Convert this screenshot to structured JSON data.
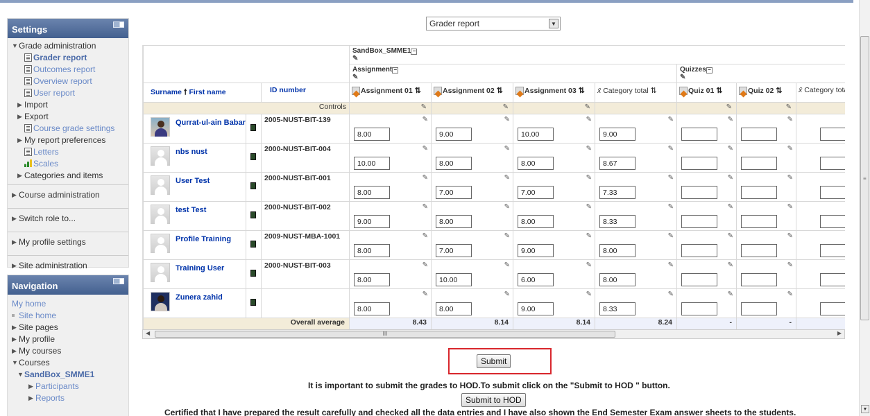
{
  "settings_block": {
    "title": "Settings",
    "items": [
      {
        "label": "Grade administration",
        "arrow": "▼"
      },
      {
        "label": "Grader report"
      },
      {
        "label": "Outcomes report"
      },
      {
        "label": "Overview report"
      },
      {
        "label": "User report"
      },
      {
        "label": "Import",
        "arrow": "▶"
      },
      {
        "label": "Export",
        "arrow": "▶"
      },
      {
        "label": "Course grade settings"
      },
      {
        "label": "My report preferences",
        "arrow": "▶"
      },
      {
        "label": "Letters"
      },
      {
        "label": "Scales"
      },
      {
        "label": "Categories and items",
        "arrow": "▶"
      },
      {
        "label": "Course administration",
        "arrow": "▶"
      },
      {
        "label": "Switch role to...",
        "arrow": "▶"
      },
      {
        "label": "My profile settings",
        "arrow": "▶"
      },
      {
        "label": "Site administration",
        "arrow": "▶"
      }
    ]
  },
  "navigation_block": {
    "title": "Navigation",
    "my_home": "My home",
    "items": [
      {
        "label": "Site home"
      },
      {
        "label": "Site pages",
        "arrow": "▶"
      },
      {
        "label": "My profile",
        "arrow": "▶"
      },
      {
        "label": "My courses",
        "arrow": "▶"
      },
      {
        "label": "Courses",
        "arrow": "▼"
      },
      {
        "label": "SandBox_SMME1",
        "arrow": "▼"
      },
      {
        "label": "Participants",
        "arrow": "▶"
      },
      {
        "label": "Reports",
        "arrow": "▶"
      }
    ]
  },
  "report_select": {
    "value": "Grader report"
  },
  "grid": {
    "course": "SandBox_SMME1",
    "category_assignment": "Assignment",
    "category_quizzes": "Quizzes",
    "col_surname": "Surname",
    "col_firstname": "First name",
    "col_idnumber": "ID number",
    "col_a1": "Assignment 01",
    "col_a2": "Assignment 02",
    "col_a3": "Assignment 03",
    "col_cat_total": "Category total",
    "col_q1": "Quiz 01",
    "col_q2": "Quiz 02",
    "col_cat_total2": "Category total",
    "controls_label": "Controls",
    "overall_label": "Overall average",
    "students": [
      {
        "name": "Qurrat-ul-ain Babar",
        "id": "2005-NUST-BIT-139",
        "a1": "8.00",
        "a2": "9.00",
        "a3": "10.00",
        "total": "9.00",
        "avatar": "photo"
      },
      {
        "name": "nbs nust",
        "id": "2000-NUST-BIT-004",
        "a1": "10.00",
        "a2": "8.00",
        "a3": "8.00",
        "total": "8.67",
        "avatar": "default"
      },
      {
        "name": "User Test",
        "id": "2000-NUST-BIT-001",
        "a1": "8.00",
        "a2": "7.00",
        "a3": "7.00",
        "total": "7.33",
        "avatar": "default"
      },
      {
        "name": "test Test",
        "id": "2000-NUST-BIT-002",
        "a1": "9.00",
        "a2": "8.00",
        "a3": "8.00",
        "total": "8.33",
        "avatar": "default"
      },
      {
        "name": "Profile Training",
        "id": "2009-NUST-MBA-1001",
        "a1": "8.00",
        "a2": "7.00",
        "a3": "9.00",
        "total": "8.00",
        "avatar": "default"
      },
      {
        "name": "Training User",
        "id": "2000-NUST-BIT-003",
        "a1": "8.00",
        "a2": "10.00",
        "a3": "6.00",
        "total": "8.00",
        "avatar": "default"
      },
      {
        "name": "Zunera zahid",
        "id": "",
        "a1": "8.00",
        "a2": "8.00",
        "a3": "9.00",
        "total": "8.33",
        "avatar": "photo2"
      }
    ],
    "averages": {
      "a1": "8.43",
      "a2": "8.14",
      "a3": "8.14",
      "total": "8.24",
      "q1": "-",
      "q2": "-"
    }
  },
  "hscroll_mark": "III",
  "submit_label": "Submit",
  "hod_message": "It is important to submit the grades to HOD.To submit click on the \"Submit to HOD \" button.",
  "submit_hod_label": "Submit to HOD",
  "certify_message": "Certified that I have prepared the result carefully and checked all the data entries and I have also shown the End Semester Exam answer sheets to the students."
}
